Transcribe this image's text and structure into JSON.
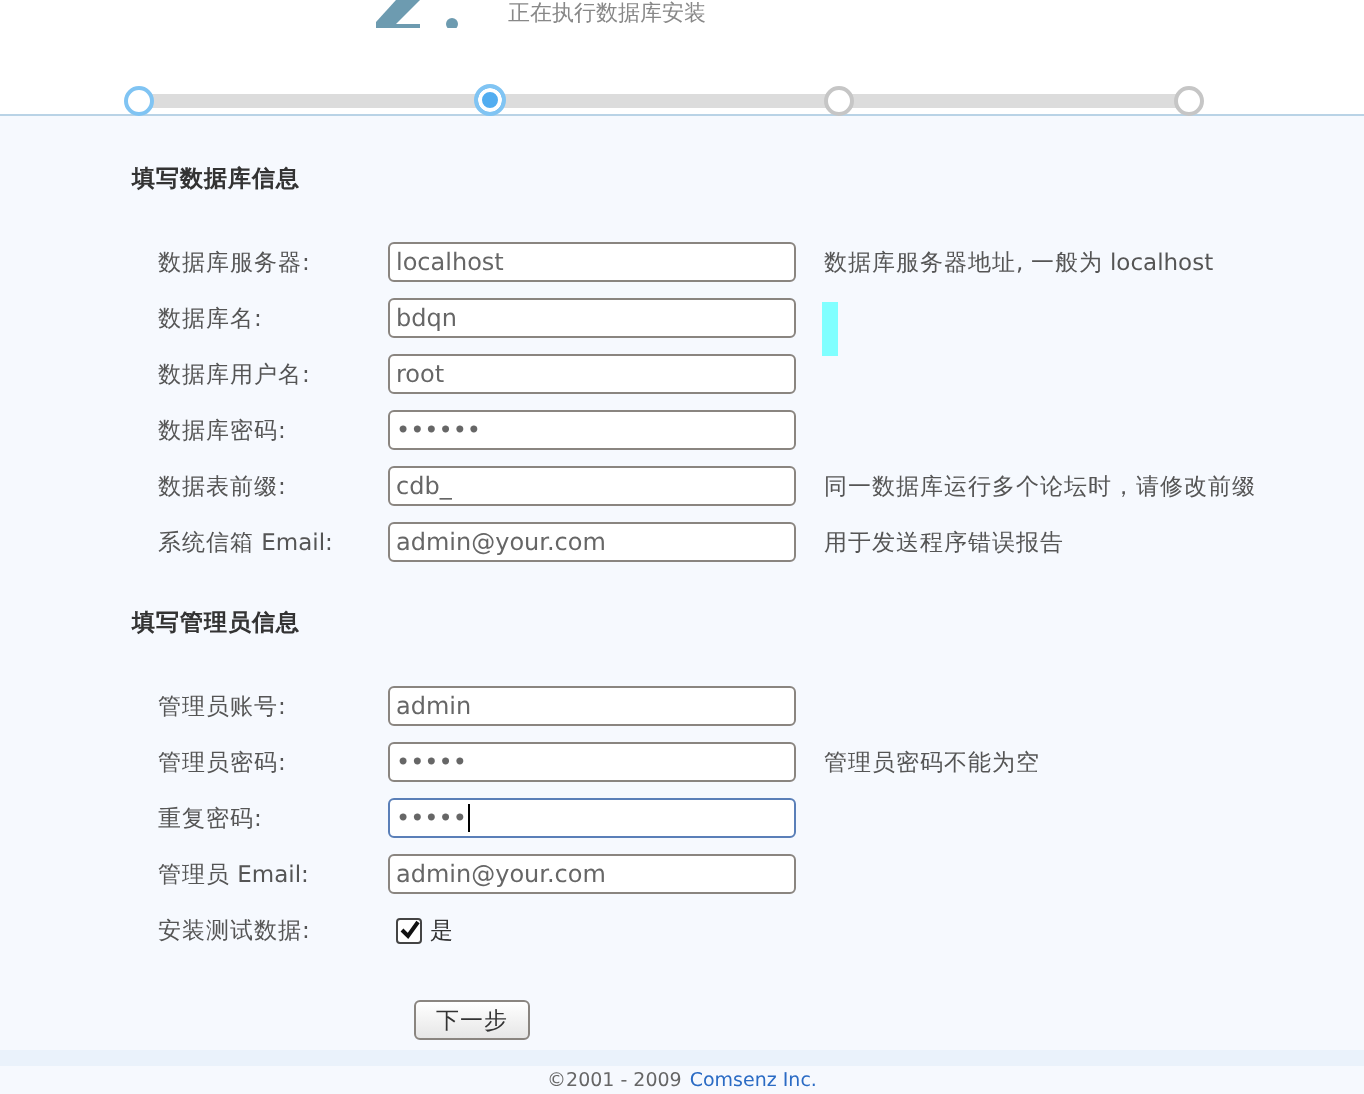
{
  "header": {
    "subtitle": "正在执行数据库安装"
  },
  "steps": [
    {
      "selected": false,
      "done": true
    },
    {
      "selected": true,
      "done": true
    },
    {
      "selected": false,
      "done": false
    },
    {
      "selected": false,
      "done": false
    }
  ],
  "sections": [
    {
      "title": "填写数据库信息",
      "rows": [
        {
          "kind": "field",
          "label": "数据库服务器:",
          "value": "localhost",
          "focused": false,
          "hint": "数据库服务器地址, 一般为 localhost"
        },
        {
          "kind": "field",
          "label": "数据库名:",
          "value": "bdqn",
          "focused": false,
          "marker": true
        },
        {
          "kind": "field",
          "label": "数据库用户名:",
          "value": "root",
          "focused": false
        },
        {
          "kind": "field",
          "label": "数据库密码:",
          "value": "••••••",
          "focused": false
        },
        {
          "kind": "field",
          "label": "数据表前缀:",
          "value": "cdb_",
          "focused": false,
          "hint": "同一数据库运行多个论坛时，请修改前缀"
        },
        {
          "kind": "field",
          "label": "系统信箱 Email:",
          "value": "admin@your.com",
          "focused": false,
          "hint": "用于发送程序错误报告"
        }
      ]
    },
    {
      "title": "填写管理员信息",
      "rows": [
        {
          "kind": "field",
          "label": "管理员账号:",
          "value": "admin",
          "focused": false
        },
        {
          "kind": "field",
          "label": "管理员密码:",
          "value": "•••••",
          "focused": false,
          "hint": "管理员密码不能为空"
        },
        {
          "kind": "field",
          "label": "重复密码:",
          "value": "•••••",
          "focused": true
        },
        {
          "kind": "field",
          "label": "管理员 Email:",
          "value": "admin@your.com",
          "focused": false
        },
        {
          "kind": "checkbox",
          "label": "安装测试数据:",
          "text": "是",
          "checked": true
        }
      ]
    }
  ],
  "next_button": "下一步",
  "footer": {
    "text": "©2001 - 2009",
    "link": "Comsenz Inc."
  }
}
